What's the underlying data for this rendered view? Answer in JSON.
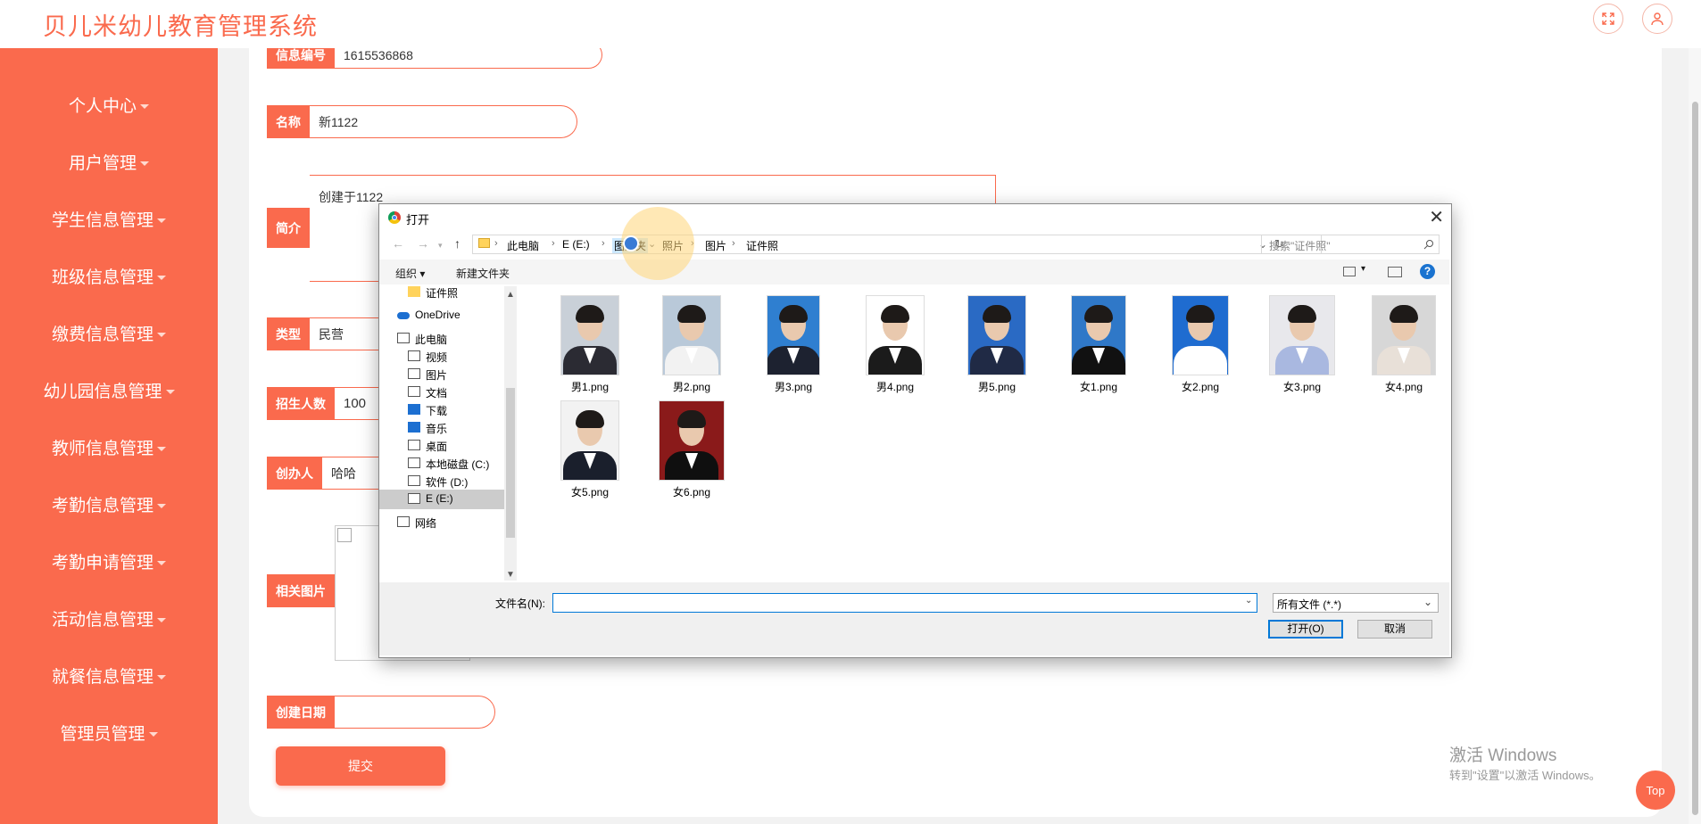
{
  "header": {
    "title": "贝儿米幼儿教育管理系统",
    "fullscreen_icon": "fullscreen-icon",
    "user_icon": "user-icon"
  },
  "sidebar": {
    "items": [
      {
        "label": "个人中心"
      },
      {
        "label": "用户管理"
      },
      {
        "label": "学生信息管理"
      },
      {
        "label": "班级信息管理"
      },
      {
        "label": "缴费信息管理"
      },
      {
        "label": "幼儿园信息管理"
      },
      {
        "label": "教师信息管理"
      },
      {
        "label": "考勤信息管理"
      },
      {
        "label": "考勤申请管理"
      },
      {
        "label": "活动信息管理"
      },
      {
        "label": "就餐信息管理"
      },
      {
        "label": "管理员管理"
      }
    ]
  },
  "form": {
    "info_no_label": "信息编号",
    "info_no_value": "1615536868",
    "name_label": "名称",
    "name_value": "新1122",
    "intro_label": "简介",
    "intro_value": "创建于1122",
    "type_label": "类型",
    "type_value": "民营",
    "enroll_label": "招生人数",
    "enroll_value": "100",
    "founder_label": "创办人",
    "founder_value": "哈哈",
    "image_label": "相关图片",
    "date_label": "创建日期",
    "date_value": "",
    "submit_label": "提交"
  },
  "top_button": "Top",
  "watermark": {
    "line1": "激活 Windows",
    "line2": "转到\"设置\"以激活 Windows。"
  },
  "dialog": {
    "title": "打开",
    "breadcrumb": [
      "此电脑",
      "E (E:)",
      "图片夹",
      "照片",
      "图片",
      "证件照"
    ],
    "search_placeholder": "搜索\"证件照\"",
    "toolbar": {
      "organize": "组织",
      "new_folder": "新建文件夹"
    },
    "tree": [
      "证件照",
      "OneDrive",
      "此电脑",
      "视频",
      "图片",
      "文档",
      "下载",
      "音乐",
      "桌面",
      "本地磁盘 (C:)",
      "软件 (D:)",
      "E (E:)",
      "网络"
    ],
    "files": [
      {
        "name": "男1.png",
        "bg": "#c9d0d8",
        "shirt": "#2b2b33"
      },
      {
        "name": "男2.png",
        "bg": "#b9c9d9",
        "shirt": "#f2f2f2"
      },
      {
        "name": "男3.png",
        "bg": "#2f7fd0",
        "shirt": "#1d2230"
      },
      {
        "name": "男4.png",
        "bg": "#ffffff",
        "shirt": "#1b1b1b"
      },
      {
        "name": "男5.png",
        "bg": "#2a6ac4",
        "shirt": "#202a45"
      },
      {
        "name": "女1.png",
        "bg": "#2f78c8",
        "shirt": "#111111"
      },
      {
        "name": "女2.png",
        "bg": "#1f6cd0",
        "shirt": "#ffffff"
      },
      {
        "name": "女3.png",
        "bg": "#e8e8ec",
        "shirt": "#a9b8e0"
      },
      {
        "name": "女4.png",
        "bg": "#d7d7d7",
        "shirt": "#e8e0d8"
      },
      {
        "name": "女5.png",
        "bg": "#f2f2f2",
        "shirt": "#1a1f2c"
      },
      {
        "name": "女6.png",
        "bg": "#8a1a1a",
        "shirt": "#0f0f0f"
      }
    ],
    "filename_label": "文件名(N):",
    "filename_value": "",
    "filter_value": "所有文件 (*.*)",
    "open_label": "打开(O)",
    "cancel_label": "取消"
  }
}
